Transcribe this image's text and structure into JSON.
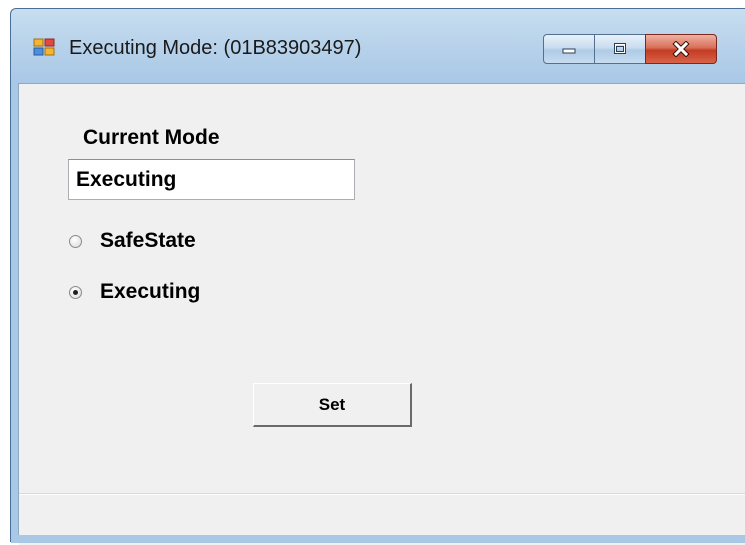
{
  "window": {
    "title": "Executing Mode: (01B83903497)",
    "icon": "windows-form-icon",
    "controls": {
      "minimize_icon": "minimize-icon",
      "maximize_icon": "maximize-icon",
      "close_icon": "close-icon"
    }
  },
  "form": {
    "current_mode_label": "Current Mode",
    "current_mode_value": "Executing",
    "options": [
      {
        "label": "SafeState",
        "selected": false
      },
      {
        "label": "Executing",
        "selected": true
      }
    ],
    "set_button_label": "Set"
  },
  "colors": {
    "form_background": "#f0f0f0",
    "frame": "#b6d1ea",
    "close_button": "#c43b22"
  }
}
